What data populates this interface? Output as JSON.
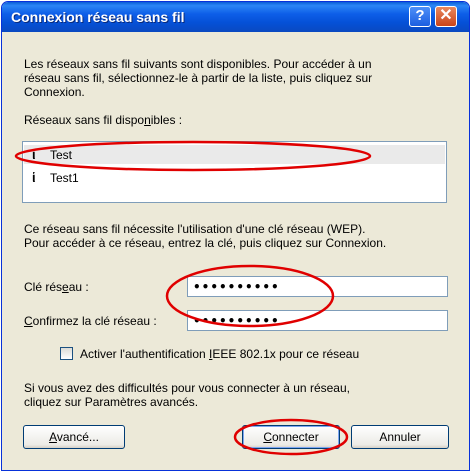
{
  "window": {
    "title": "Connexion réseau sans fil",
    "help_glyph": "?",
    "close_glyph": "✕"
  },
  "intro": {
    "line1": "Les réseaux sans fil suivants sont disponibles. Pour accéder à un",
    "line2": "réseau sans fil, sélectionnez-le à partir de la liste, puis cliquez sur",
    "line3": "Connexion."
  },
  "networks": {
    "label_pre": "Réseaux sans fil dispo",
    "label_key": "n",
    "label_post": "ibles :",
    "icon": "antenna-icon",
    "icon_glyph": "ἱ",
    "items": [
      {
        "name": "Test",
        "selected": true
      },
      {
        "name": "Test1",
        "selected": false
      }
    ]
  },
  "wep_info": {
    "line1": "Ce réseau sans fil nécessite l'utilisation d'une clé réseau (WEP).",
    "line2": "Pour accéder à ce réseau, entrez la clé, puis cliquez sur Connexion."
  },
  "key_field": {
    "label_pre": "Clé rés",
    "label_key": "e",
    "label_post": "au :",
    "value": "••••••••••"
  },
  "confirm_field": {
    "label_pre": "",
    "label_key": "C",
    "label_post": "onfirmez la clé réseau :",
    "value": "••••••••••"
  },
  "ieee": {
    "label_pre": "Activer l'authentification ",
    "label_key": "I",
    "label_post": "EEE 802.1x pour ce réseau",
    "checked": false
  },
  "help_text": {
    "line1": "Si vous avez des difficultés pour vous connecter à un réseau,",
    "line2": "cliquez sur Paramètres avancés."
  },
  "buttons": {
    "advanced_key": "A",
    "advanced_rest": "vancé...",
    "connect_key": "C",
    "connect_rest": "onnecter",
    "cancel": "Annuler"
  },
  "colors": {
    "title_bar": "#0a5fd8",
    "dialog_bg": "#ece9d8",
    "annotation": "#e00000"
  }
}
